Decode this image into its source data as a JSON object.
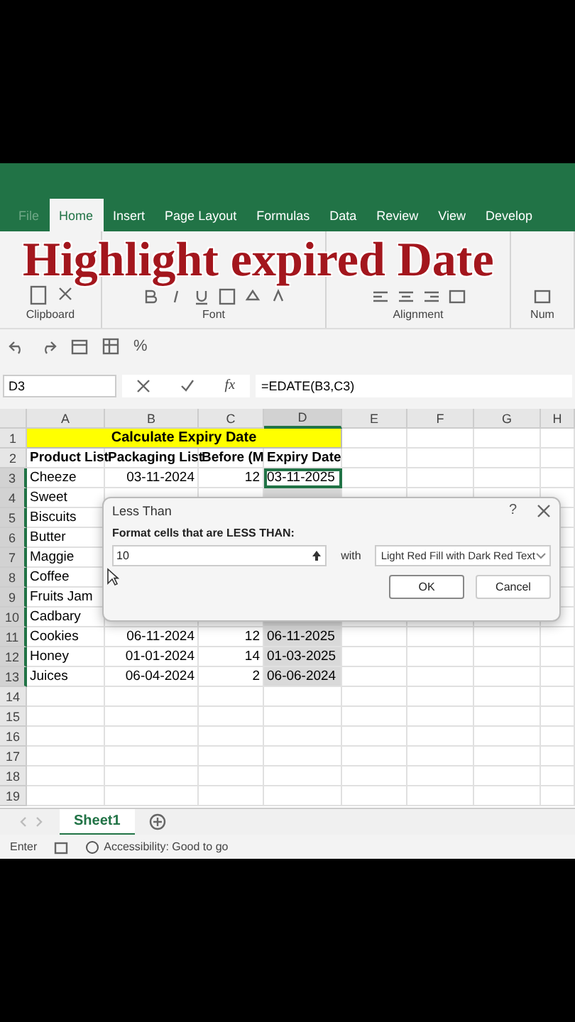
{
  "overlay_title": "Highlight expired Date",
  "ribbon_tabs": [
    {
      "label": "File",
      "selected": false
    },
    {
      "label": "Home",
      "selected": true
    },
    {
      "label": "Insert",
      "selected": false
    },
    {
      "label": "Page Layout",
      "selected": false
    },
    {
      "label": "Formulas",
      "selected": false
    },
    {
      "label": "Data",
      "selected": false
    },
    {
      "label": "Review",
      "selected": false
    },
    {
      "label": "View",
      "selected": false
    },
    {
      "label": "Develop",
      "selected": false
    }
  ],
  "ribbon_groups": [
    "Clipboard",
    "Font",
    "Alignment",
    "Num"
  ],
  "quick_access": {
    "percent": "%"
  },
  "formula_bar": {
    "name_box": "D3",
    "function_label": "fx",
    "formula": "=EDATE(B3,C3)"
  },
  "columns": [
    {
      "label": "A",
      "selected": false
    },
    {
      "label": "B",
      "selected": false
    },
    {
      "label": "C",
      "selected": false
    },
    {
      "label": "D",
      "selected": true
    },
    {
      "label": "E",
      "selected": false
    },
    {
      "label": "F",
      "selected": false
    },
    {
      "label": "G",
      "selected": false
    },
    {
      "label": "H",
      "selected": false
    }
  ],
  "rows": [
    {
      "number": "1",
      "kind": "title",
      "selected": false,
      "cells": [
        "Calculate Expiry Date"
      ]
    },
    {
      "number": "2",
      "kind": "header",
      "selected": false,
      "cells": [
        "Product List",
        "Packaging List",
        "Before (M",
        "Expiry Date"
      ]
    },
    {
      "number": "3",
      "kind": "data",
      "selected": true,
      "active": true,
      "cells": [
        "Cheeze",
        "03-11-2024",
        "12",
        "03-11-2025"
      ]
    },
    {
      "number": "4",
      "kind": "data",
      "selected": true,
      "active": false,
      "cells": [
        "Sweet"
      ]
    },
    {
      "number": "5",
      "kind": "data",
      "selected": true,
      "active": false,
      "cells": [
        "Biscuits"
      ]
    },
    {
      "number": "6",
      "kind": "data",
      "selected": true,
      "active": false,
      "cells": [
        "Butter"
      ]
    },
    {
      "number": "7",
      "kind": "data",
      "selected": true,
      "active": false,
      "cells": [
        "Maggie"
      ]
    },
    {
      "number": "8",
      "kind": "data",
      "selected": true,
      "active": false,
      "cells": [
        "Coffee"
      ]
    },
    {
      "number": "9",
      "kind": "data",
      "selected": true,
      "active": false,
      "cells": [
        "Fruits Jam"
      ]
    },
    {
      "number": "10",
      "kind": "data",
      "selected": true,
      "active": false,
      "cells": [
        "Cadbary"
      ]
    },
    {
      "number": "11",
      "kind": "data",
      "selected": true,
      "active": false,
      "cells": [
        "Cookies",
        "06-11-2024",
        "12",
        "06-11-2025"
      ]
    },
    {
      "number": "12",
      "kind": "data",
      "selected": true,
      "active": false,
      "cells": [
        "Honey",
        "01-01-2024",
        "14",
        "01-03-2025"
      ]
    },
    {
      "number": "13",
      "kind": "data",
      "selected": true,
      "active": false,
      "cells": [
        "Juices",
        "06-04-2024",
        "2",
        "06-06-2024"
      ]
    },
    {
      "number": "14",
      "kind": "empty",
      "selected": false,
      "cells": []
    },
    {
      "number": "15",
      "kind": "empty",
      "selected": false,
      "cells": []
    },
    {
      "number": "16",
      "kind": "empty",
      "selected": false,
      "cells": []
    },
    {
      "number": "17",
      "kind": "empty",
      "selected": false,
      "cells": []
    },
    {
      "number": "18",
      "kind": "empty",
      "selected": false,
      "cells": []
    },
    {
      "number": "19",
      "kind": "empty",
      "selected": false,
      "cells": []
    }
  ],
  "dialog": {
    "title": "Less Than",
    "help": "?",
    "prompt": "Format cells that are LESS THAN:",
    "value": "10",
    "with_label": "with",
    "format": "Light Red Fill with Dark Red Text",
    "buttons": [
      {
        "label": "OK",
        "selected": true
      },
      {
        "label": "Cancel",
        "selected": false
      }
    ]
  },
  "sheet_tabs": [
    {
      "label": "Sheet1",
      "selected": true
    }
  ],
  "status_bar": {
    "mode": "Enter",
    "accessibility": "Accessibility: Good to go"
  }
}
